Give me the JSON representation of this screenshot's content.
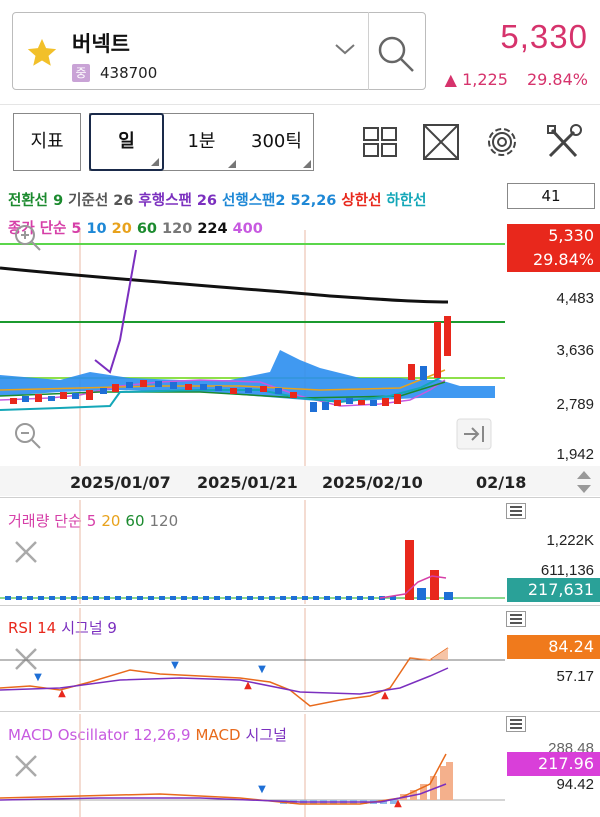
{
  "stock": {
    "name": "버넥트",
    "market_badge": "중",
    "code": "438700",
    "price": "5,330",
    "change_arrow": "▲",
    "change_amount": "1,225",
    "change_rate": "29.84%"
  },
  "toolbar": {
    "indicator_label": "지표",
    "period_day": "일",
    "period_min": "1분",
    "period_tick": "300틱"
  },
  "legend": {
    "line1": [
      {
        "text": "전환선 9",
        "color": "#1b8a2e"
      },
      {
        "text": "기준선 26",
        "color": "#555555"
      },
      {
        "text": "후행스팬 26",
        "color": "#7b2fbf"
      },
      {
        "text": "선행스팬2 52,26",
        "color": "#1e88d6"
      },
      {
        "text": "상한선",
        "color": "#e8281c"
      },
      {
        "text": "하한선",
        "color": "#14a7b8"
      }
    ],
    "line2": [
      {
        "text": "종가",
        "color": "#d63fa8"
      },
      {
        "text": "단순",
        "color": "#d63fa8"
      },
      {
        "text": "5",
        "color": "#d63fa8"
      },
      {
        "text": "10",
        "color": "#1e88d6"
      },
      {
        "text": "20",
        "color": "#e8a21c"
      },
      {
        "text": "60",
        "color": "#1b8a2e"
      },
      {
        "text": "120",
        "color": "#777777"
      },
      {
        "text": "224",
        "color": "#111111"
      },
      {
        "text": "400",
        "color": "#c75ae0"
      }
    ],
    "count": "41"
  },
  "main_axis": {
    "labels": [
      "4,483",
      "3,636",
      "2,789",
      "1,942"
    ],
    "current_price": "5,330",
    "current_rate": "29.84%"
  },
  "dates": [
    "2025/01/07",
    "2025/01/21",
    "2025/02/10",
    "02/18"
  ],
  "volume": {
    "title_parts": [
      {
        "text": "거래량 단순",
        "color": "#d63fa8"
      },
      {
        "text": "5",
        "color": "#d63fa8"
      },
      {
        "text": "20",
        "color": "#e8a21c"
      },
      {
        "text": "60",
        "color": "#1b8a2e"
      },
      {
        "text": "120",
        "color": "#777777"
      }
    ],
    "labels": [
      "1,222K",
      "611,136"
    ],
    "current": "217,631"
  },
  "rsi": {
    "title_parts": [
      {
        "text": "RSI 14",
        "color": "#e8281c"
      },
      {
        "text": "시그널 9",
        "color": "#7b2fbf"
      }
    ],
    "current": "84.24",
    "label": "57.17"
  },
  "macd": {
    "title_parts": [
      {
        "text": "MACD Oscillator 12,26,9",
        "color": "#c75ae0"
      },
      {
        "text": "MACD",
        "color": "#e86a1c"
      },
      {
        "text": "시그널",
        "color": "#7b2fbf"
      }
    ],
    "label_top": "288.48",
    "current": "217.96",
    "label": "94.42"
  },
  "colors": {
    "up": "#d6336c",
    "candle_up": "#e8281c",
    "candle_down": "#1e6fd6",
    "cloud": "#2b8ef0",
    "volume_tag": "#2aa198",
    "rsi_tag": "#f07a1c",
    "macd_tag": "#d93fd9"
  }
}
